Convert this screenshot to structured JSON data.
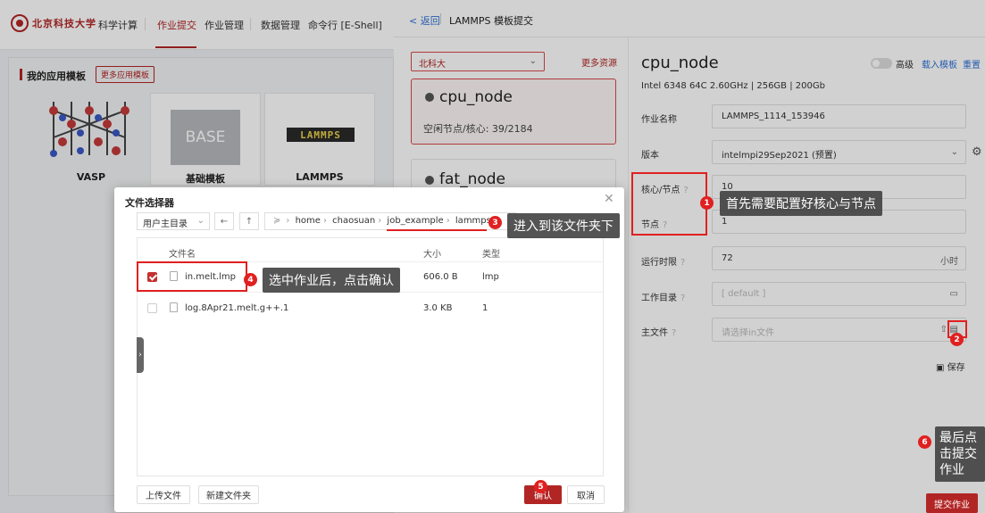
{
  "topnav": {
    "logo_text": "北京科技大学",
    "items": [
      "科学计算",
      "作业提交",
      "作业管理",
      "数据管理",
      "命令行 [E-Shell]"
    ]
  },
  "left": {
    "title": "我的应用模板",
    "more_label": "更多应用模板",
    "templates": [
      {
        "name": "VASP"
      },
      {
        "name": "基础模板",
        "image_text": "BASE"
      },
      {
        "name": "LAMMPS",
        "image_text": "LAMMPS"
      }
    ]
  },
  "header": {
    "back_label": "< 返回",
    "title": "LAMMPS 模板提交"
  },
  "resource": {
    "site_select": "北科大",
    "more_label": "更多资源",
    "nodes": [
      {
        "name": "cpu_node",
        "idle": "空闲节点/核心: 39/2184"
      },
      {
        "name": "fat_node"
      }
    ]
  },
  "config": {
    "title": "cpu_node",
    "spec": "Intel 6348 64C 2.60GHz | 256GB | 200Gb",
    "advanced_label": "高级",
    "load_template": "载入模板",
    "reset": "重置",
    "fields": {
      "job_name": {
        "label": "作业名称",
        "value": "LAMMPS_1114_153946"
      },
      "version": {
        "label": "版本",
        "value": "intelmpi29Sep2021 (预置)"
      },
      "cores": {
        "label": "核心/节点",
        "value": "10"
      },
      "nodes": {
        "label": "节点",
        "value": "1"
      },
      "runtime": {
        "label": "运行时限",
        "value": "72",
        "unit": "小时"
      },
      "workdir": {
        "label": "工作目录",
        "placeholder": "[ default ]"
      },
      "mainfile": {
        "label": "主文件",
        "placeholder": "请选择in文件"
      }
    },
    "save_label": "保存",
    "submit_label": "提交作业"
  },
  "dialog": {
    "title": "文件选择器",
    "dir_select": "用户主目录",
    "path": [
      "home",
      "chaosuan",
      "job_example",
      "lammps"
    ],
    "columns": {
      "name": "文件名",
      "size": "大小",
      "type": "类型"
    },
    "files": [
      {
        "name": "in.melt.lmp",
        "size": "606.0 B",
        "type": "lmp",
        "checked": true
      },
      {
        "name": "log.8Apr21.melt.g++.1",
        "size": "3.0 KB",
        "type": "1",
        "checked": false
      }
    ],
    "upload_label": "上传文件",
    "newfolder_label": "新建文件夹",
    "confirm_label": "确认",
    "cancel_label": "取消"
  },
  "annotations": {
    "step1": "首先需要配置好核心与节点",
    "step3": "进入到该文件夹下",
    "step4": "选中作业后，点击确认",
    "step6": "最后点击提交作业",
    "numbers": [
      "1",
      "2",
      "3",
      "4",
      "5",
      "6"
    ]
  },
  "colors": {
    "accent": "#b22525",
    "link": "#2f72d6",
    "annotation": "#e02020"
  }
}
